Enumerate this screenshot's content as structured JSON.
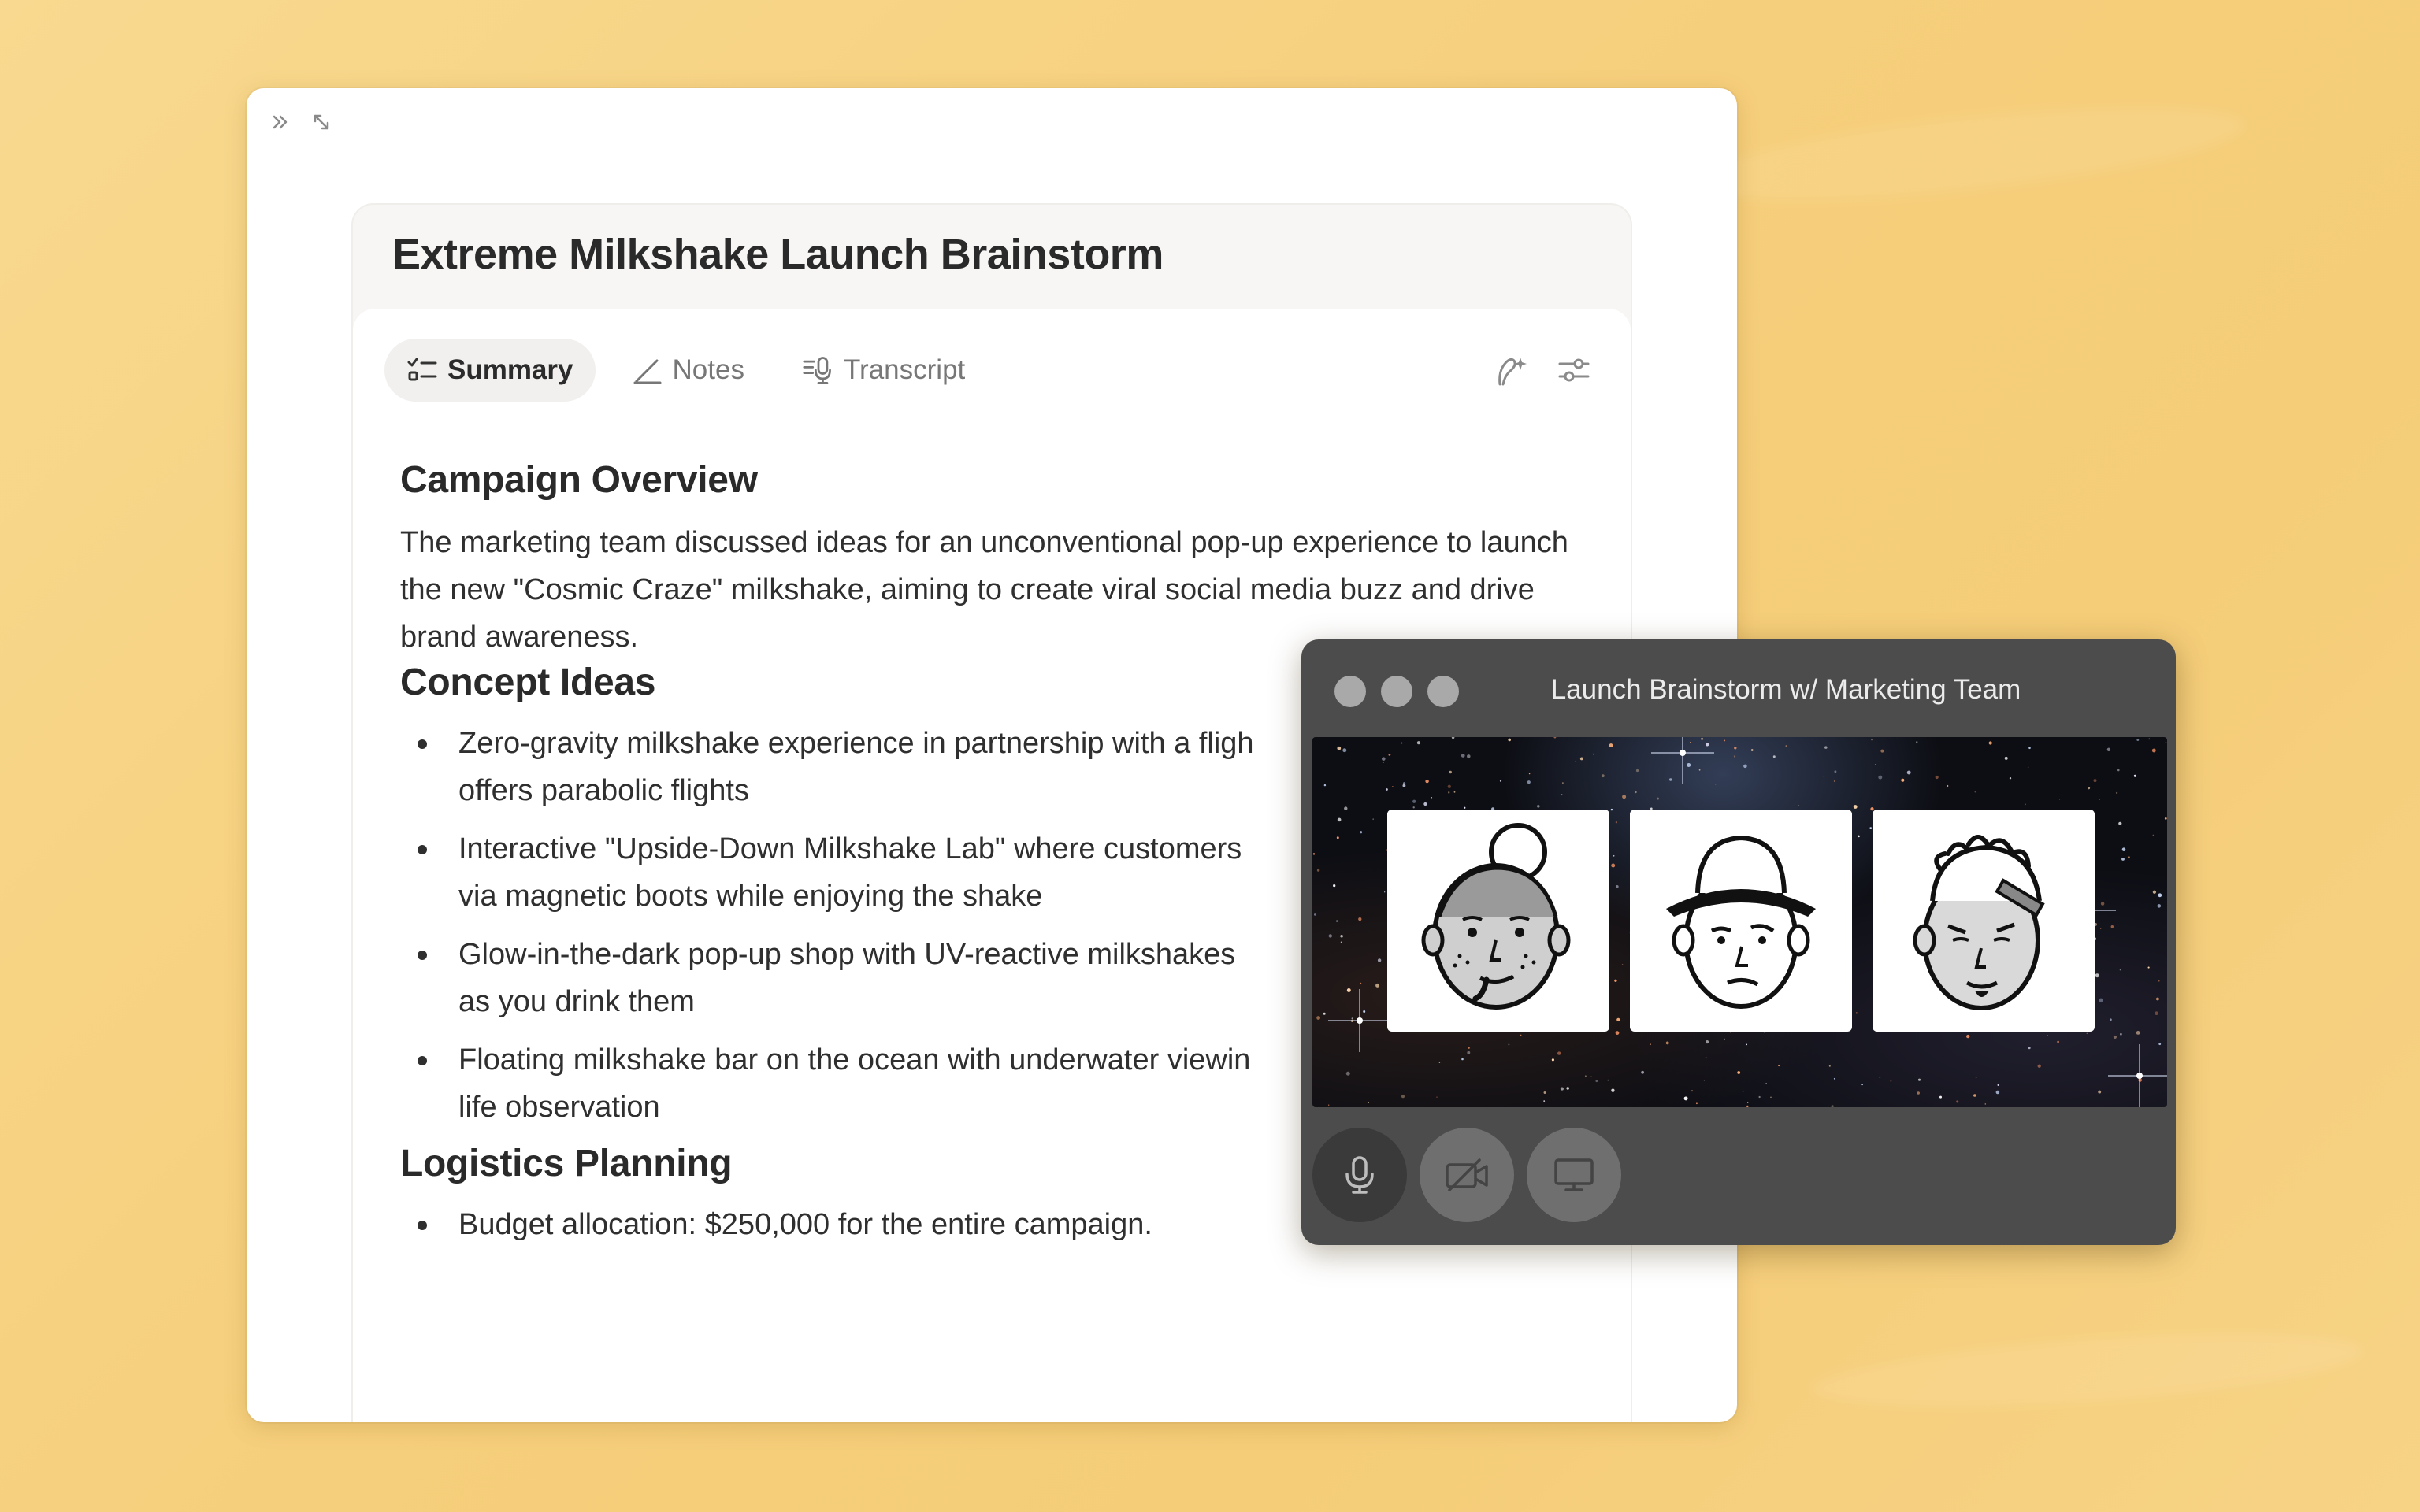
{
  "document": {
    "title": "Extreme Milkshake Launch Brainstorm",
    "tabs": [
      {
        "label": "Summary",
        "icon": "checklist-icon",
        "active": true
      },
      {
        "label": "Notes",
        "icon": "pen-icon",
        "active": false
      },
      {
        "label": "Transcript",
        "icon": "transcript-mic-icon",
        "active": false
      }
    ],
    "toolbar_icons": [
      "sparkle-edit-icon",
      "sliders-icon"
    ],
    "window_icons": [
      "sidebar-collapse-icon",
      "expand-icon"
    ],
    "sections": [
      {
        "heading": "Campaign Overview",
        "paragraph": "The marketing team discussed ideas for an unconventional pop-up experience to launch the new \"Cosmic Craze\" milkshake, aiming to create viral social media buzz and drive brand awareness."
      },
      {
        "heading": "Concept Ideas",
        "bullets": [
          "Zero-gravity milkshake experience in partnership with a fligh",
          "offers parabolic flights",
          "Interactive \"Upside-Down Milkshake Lab\" where customers",
          "via magnetic boots while enjoying the shake",
          "Glow-in-the-dark pop-up shop with UV-reactive milkshakes",
          "as you drink them",
          "Floating milkshake bar on the ocean with underwater viewin",
          "life observation"
        ]
      },
      {
        "heading": "Logistics Planning",
        "bullets": [
          "Budget allocation: $250,000 for the entire campaign."
        ]
      }
    ]
  },
  "call": {
    "title": "Launch Brainstorm w/ Marketing Team",
    "participants": [
      "participant-bun-hair-avatar",
      "participant-bucket-hat-avatar",
      "participant-dreadlocks-avatar"
    ],
    "controls": [
      {
        "name": "microphone-button",
        "icon": "microphone-icon"
      },
      {
        "name": "camera-off-button",
        "icon": "camera-off-icon"
      },
      {
        "name": "screen-share-button",
        "icon": "monitor-icon"
      }
    ],
    "colors": {
      "window": "#4c4c4c",
      "traffic_light": "#a9a9a9",
      "mic_button": "#3a3a3a",
      "control_button": "#6f6f6f"
    }
  },
  "colors": {
    "background": "#f6cf7c",
    "text": "#2b2b2b",
    "active_tab": "#f1f0ee"
  }
}
